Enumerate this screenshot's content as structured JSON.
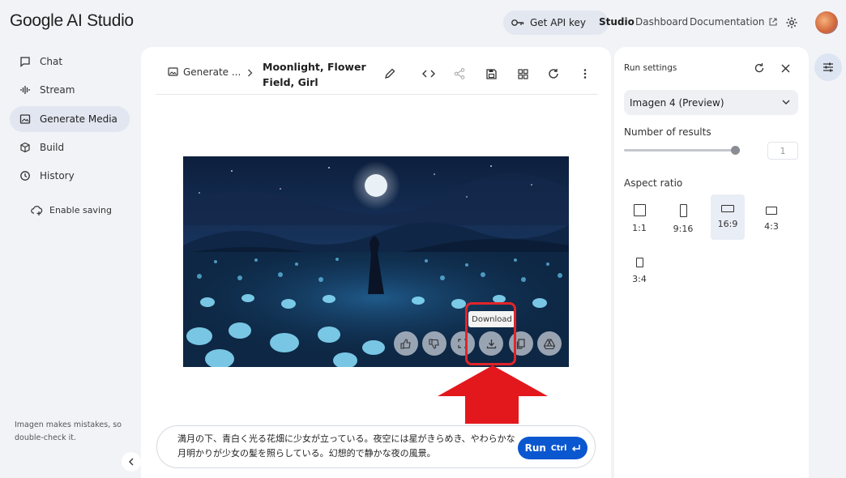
{
  "header": {
    "logo": "Google AI Studio",
    "api_key_label": "Get API key",
    "nav": [
      "Studio",
      "Dashboard",
      "Documentation"
    ]
  },
  "sidebar": {
    "items": [
      {
        "label": "Chat",
        "icon": "chat-icon"
      },
      {
        "label": "Stream",
        "icon": "waveform-icon"
      },
      {
        "label": "Generate Media",
        "icon": "image-icon"
      },
      {
        "label": "Build",
        "icon": "build-icon"
      },
      {
        "label": "History",
        "icon": "history-icon"
      }
    ],
    "enable_saving": "Enable saving",
    "disclaimer": "Imagen makes mistakes, so double-check it."
  },
  "main": {
    "breadcrumb": "Generate ...",
    "title": "Moonlight, Flower Field, Girl",
    "tooltip": "Download",
    "prompt": "満月の下、青白く光る花畑に少女が立っている。夜空には星がきらめき、やわらかな月明かりが少女の髪を照らしている。幻想的で静かな夜の風景。",
    "run_label": "Run",
    "run_shortcut": "Ctrl"
  },
  "run_settings": {
    "title": "Run settings",
    "model": "Imagen 4 (Preview)",
    "results_label": "Number of results",
    "results_value": "1",
    "aspect_label": "Aspect ratio",
    "aspect_ratios": [
      "1:1",
      "9:16",
      "16:9",
      "4:3",
      "3:4"
    ],
    "selected_aspect": "16:9"
  },
  "colors": {
    "accent": "#0b57d0",
    "highlight": "#e0252a",
    "arrow": "#e3181d"
  }
}
